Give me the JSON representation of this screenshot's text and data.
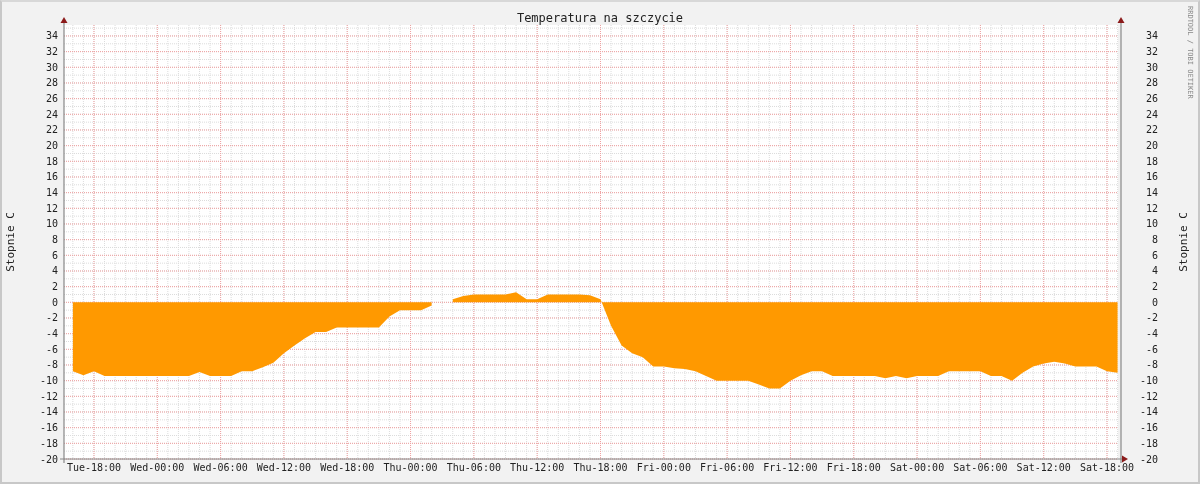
{
  "graph": {
    "credit": "RRDTOOL / TOBI OETIKER",
    "right_axis": {
      "label": "Stopnie C",
      "ticks": [
        "34",
        "32",
        "30",
        "28",
        "26",
        "24",
        "22",
        "20",
        "18",
        "16",
        "14",
        "12",
        "10",
        "8",
        "6",
        "4",
        "2",
        "0",
        "-2",
        "-4",
        "-6",
        "-8",
        "-10",
        "-12",
        "-14",
        "-16",
        "-18",
        "-20"
      ]
    },
    "chart_data": {
      "type": "area",
      "title": "Temperatura na szczycie",
      "ylabel": "Stopnie C",
      "categories": [
        null,
        null,
        "Tue-18:00",
        null,
        null,
        null,
        null,
        null,
        "Wed-00:00",
        null,
        null,
        null,
        null,
        null,
        "Wed-06:00",
        null,
        null,
        null,
        null,
        null,
        "Wed-12:00",
        null,
        null,
        null,
        null,
        null,
        "Wed-18:00",
        null,
        null,
        null,
        null,
        null,
        "Thu-00:00",
        null,
        null,
        null,
        null,
        null,
        "Thu-06:00",
        null,
        null,
        null,
        null,
        null,
        "Thu-12:00",
        null,
        null,
        null,
        null,
        null,
        "Thu-18:00",
        null,
        null,
        null,
        null,
        null,
        "Fri-00:00",
        null,
        null,
        null,
        null,
        null,
        "Fri-06:00",
        null,
        null,
        null,
        null,
        null,
        "Fri-12:00",
        null,
        null,
        null,
        null,
        null,
        "Fri-18:00",
        null,
        null,
        null,
        null,
        null,
        "Sat-00:00",
        null,
        null,
        null,
        null,
        null,
        "Sat-06:00",
        null,
        null,
        null,
        null,
        null,
        "Sat-12:00",
        null,
        null,
        null,
        null,
        null,
        "Sat-18:00",
        null
      ],
      "series": [
        {
          "color": "#ff9900",
          "values": [
            -8.8,
            -9.3,
            -8.8,
            -9.4,
            -9.4,
            -9.4,
            -9.4,
            -9.4,
            -9.4,
            -9.4,
            -9.4,
            -9.4,
            -8.9,
            -9.4,
            -9.4,
            -9.4,
            -8.8,
            -8.8,
            -8.3,
            -7.7,
            -6.5,
            -5.5,
            -4.6,
            -3.8,
            -3.8,
            -3.2,
            -3.2,
            -3.2,
            -3.2,
            -3.2,
            -1.8,
            -1.0,
            -1.0,
            -1.0,
            -0.4,
            null,
            0.4,
            0.8,
            1.0,
            1.0,
            1.0,
            1.0,
            1.3,
            0.4,
            0.4,
            1.0,
            1.0,
            1.0,
            1.0,
            0.9,
            0.4,
            -3.0,
            -5.5,
            -6.5,
            -7.0,
            -8.2,
            -8.2,
            -8.4,
            -8.5,
            -8.8,
            -9.4,
            -10,
            -10,
            -10,
            -10,
            -10.5,
            -11,
            -11,
            -10,
            -9.3,
            -8.8,
            -8.8,
            -9.4,
            -9.4,
            -9.4,
            -9.4,
            -9.4,
            -9.7,
            -9.4,
            -9.7,
            -9.4,
            -9.4,
            -9.4,
            -8.8,
            -8.8,
            -8.8,
            -8.8,
            -9.4,
            -9.4,
            -10,
            -9.0,
            -8.2,
            -7.8,
            -7.6,
            -7.8,
            -8.2,
            -8.2,
            -8.2,
            -8.8,
            -9.0
          ]
        }
      ],
      "grid": true,
      "ylim": [
        -20,
        35.4
      ],
      "yticks": [
        -20,
        -18,
        -16,
        -14,
        -12,
        -10,
        -8,
        -6,
        -4,
        -2,
        0,
        2,
        4,
        6,
        8,
        10,
        12,
        14,
        16,
        18,
        20,
        22,
        24,
        26,
        28,
        30,
        32,
        34
      ]
    }
  }
}
